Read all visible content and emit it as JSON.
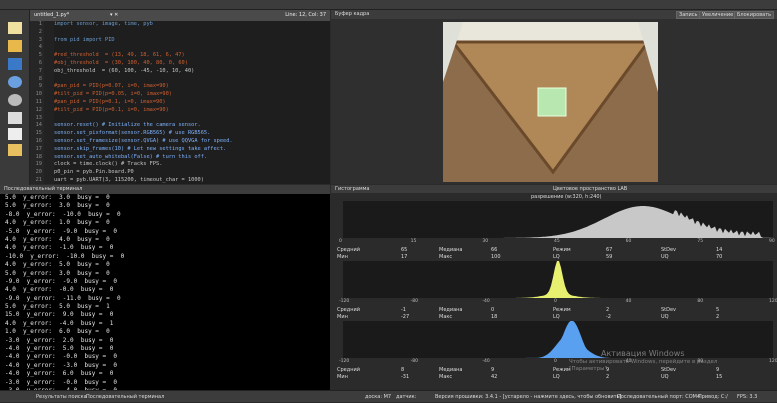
{
  "editor": {
    "file_tab": "untitled_1.py*",
    "position": "Line: 12, Col: 37",
    "lines": [
      "import sensor, image, time, pyb",
      "",
      "from pid import PID",
      "",
      "#red_threshold  = (13, 49, 18, 61, 6, 47)",
      "#obj_threshold  = (30, 100, 40, 80, 0, 60)",
      "obj_threshold  = (60, 100, -45, -10, 10, 40)",
      "",
      "#pan_pid = PID(p=0.07, i=0, imax=90)",
      "#tilt_pid = PID(p=0.05, i=0, imax=90)",
      "#pan_pid = PID(p=0.1, i=0, imax=90)",
      "#tilt_pid = PID(p=0.1, i=0, imax=90)",
      "",
      "sensor.reset() # Initialize the camera sensor.",
      "sensor.set_pixformat(sensor.RGB565) # use RGB565.",
      "sensor.set_framesize(sensor.QVGA) # use QQVGA for speed.",
      "sensor.skip_frames(10) # Let new settings take affect.",
      "sensor.set_auto_whitebal(False) # turn this off.",
      "clock = time.clock() # Tracks FPS.",
      "p0_pin = pyb.Pin.board.P0",
      "uart = pyb.UART(3, 115200, timeout_char = 1000)",
      "",
      "def find_max(blobs):"
    ],
    "line_numbers": [
      "1",
      "2",
      "3",
      "4",
      "5",
      "6",
      "7",
      "8",
      "9",
      "10",
      "11",
      "12",
      "13",
      "14",
      "15",
      "16",
      "17",
      "18",
      "19",
      "20",
      "21",
      "22",
      "23"
    ]
  },
  "terminal": {
    "title": "Последовательный терминал",
    "lines": [
      "5.0  y_error:  3.0  busy =  0",
      "5.0  y_error:  3.0  busy =  0",
      "-8.0  y_error:  -10.0  busy =  0",
      "4.0  y_error:  1.0  busy =  0",
      "-5.0  y_error:  -9.0  busy =  0",
      "4.0  y_error:  4.0  busy =  0",
      "4.0  y_error:  -1.0  busy =  0",
      "-10.0  y_error:  -10.0  busy =  0",
      "4.0  y_error:  5.0  busy =  0",
      "5.0  y_error:  3.0  busy =  0",
      "-9.0  y_error:  -9.0  busy =  0",
      "4.0  y_error:  -0.0  busy =  0",
      "-9.0  y_error:  -11.0  busy =  0",
      "5.0  y_error:  5.0  busy =  1",
      "15.0  y_error:  9.0  busy =  0",
      "4.0  y_error:  -4.0  busy =  1",
      "1.0  y_error:  6.0  busy =  0",
      "-3.0  y_error:  2.0  busy =  0",
      "-4.0  y_error:  5.0  busy =  0",
      "-4.0  y_error:  -0.0  busy =  0",
      "-4.0  y_error:  -3.0  busy =  0",
      "-4.0  y_error:  6.0  busy =  0",
      "-3.0  y_error:  -0.0  busy =  0",
      "-3.0  y_error:  -4.0  busy =  0",
      "-4.0  y_error:  4.0  busy =  0",
      "-2.0  y_error:  2.0  busy =  0"
    ]
  },
  "framebuffer": {
    "title": "Буфер кадра",
    "record": "Запись",
    "zoom": "Увеличение",
    "lock": "Блокировать"
  },
  "histogram": {
    "title": "Гистограмма",
    "colorspace": "Цветовое пространство LAB",
    "resolution": "разрешение (w:320, h:240)",
    "panels": [
      {
        "color": "#c8c8c8",
        "ticks": [
          "0",
          "15",
          "30",
          "45",
          "60",
          "75",
          "90"
        ],
        "row1": [
          "Средний",
          "65",
          "Медиана",
          "66",
          "Режим",
          "67",
          "StDev",
          "14"
        ],
        "row2": [
          "Мин",
          "17",
          "Макс",
          "100",
          "LQ",
          "59",
          "UQ",
          "70"
        ]
      },
      {
        "color": "#e8f070",
        "ticks": [
          "-120",
          "-80",
          "-40",
          "0",
          "40",
          "80",
          "120"
        ],
        "row1": [
          "Средний",
          "-1",
          "Медиана",
          "0",
          "Режим",
          "2",
          "StDev",
          "5"
        ],
        "row2": [
          "Мин",
          "-27",
          "Макс",
          "18",
          "LQ",
          "-2",
          "UQ",
          "2"
        ]
      },
      {
        "color": "#5aa0f0",
        "ticks": [
          "-120",
          "-80",
          "-40",
          "0",
          "40",
          "80",
          "120"
        ],
        "row1": [
          "Средний",
          "8",
          "Медиана",
          "9",
          "Режим",
          "9",
          "StDev",
          "9"
        ],
        "row2": [
          "Мин",
          "-31",
          "Макс",
          "42",
          "LQ",
          "2",
          "UQ",
          "15"
        ]
      }
    ]
  },
  "watermark": {
    "line1": "Активация Windows",
    "line2": "Чтобы активировать Windows, перейдите в раздел",
    "line3": "\"Параметры\"."
  },
  "status": {
    "tab_search": "Результаты поиска",
    "tab_terminal": "Последовательный терминал",
    "board": "доска: M7",
    "sensor": "датчик:",
    "firmware": "Версия прошивки: 3.4.1 - [устарело - нажмите здесь, чтобы обновить]",
    "port": "Последовательный порт: COM4",
    "drive": "Привод: C:/",
    "fps": "FPS:  3.3"
  },
  "colors": {
    "accent": "#c8c8c8",
    "terminal_bg": "#000000",
    "editor_bg": "#1e1e1e"
  }
}
